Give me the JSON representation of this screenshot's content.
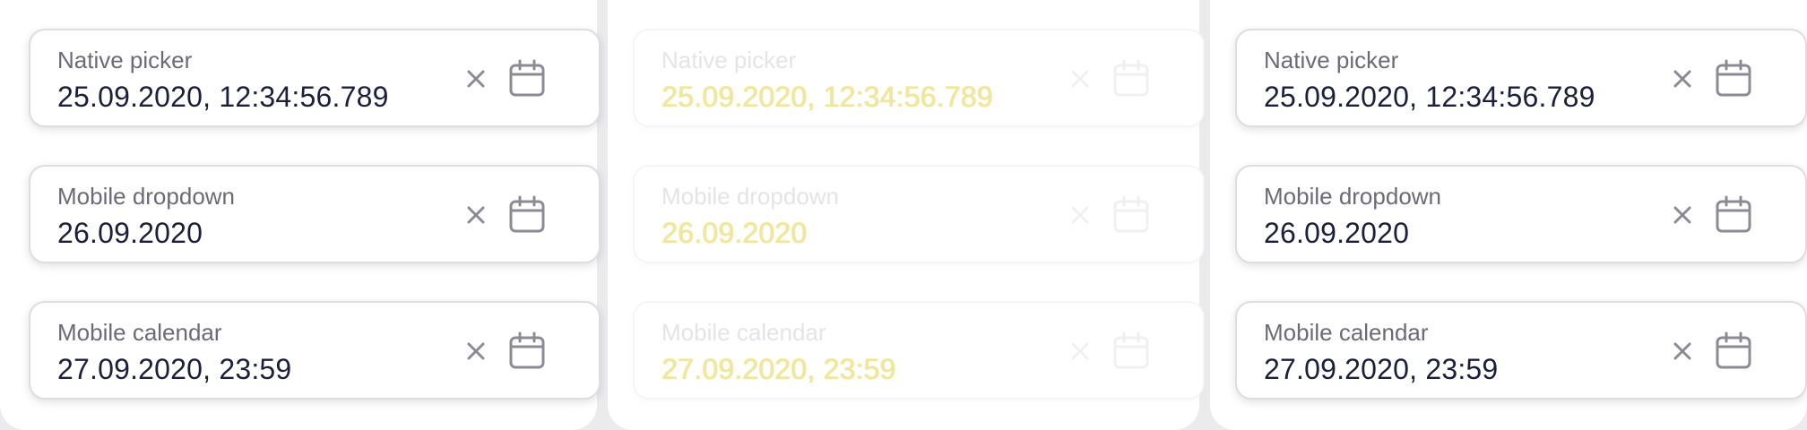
{
  "columns": [
    {
      "state": "enabled",
      "fields": [
        {
          "label": "Native picker",
          "value": "25.09.2020, 12:34:56.789"
        },
        {
          "label": "Mobile dropdown",
          "value": "26.09.2020"
        },
        {
          "label": "Mobile calendar",
          "value": "27.09.2020, 23:59"
        }
      ]
    },
    {
      "state": "disabled",
      "fields": [
        {
          "label": "Native picker",
          "value": "25.09.2020, 12:34:56.789"
        },
        {
          "label": "Mobile dropdown",
          "value": "26.09.2020"
        },
        {
          "label": "Mobile calendar",
          "value": "27.09.2020, 23:59"
        }
      ]
    },
    {
      "state": "enabled",
      "fields": [
        {
          "label": "Native picker",
          "value": "25.09.2020, 12:34:56.789"
        },
        {
          "label": "Mobile dropdown",
          "value": "26.09.2020"
        },
        {
          "label": "Mobile calendar",
          "value": "27.09.2020, 23:59"
        }
      ]
    }
  ],
  "icons": {
    "clear": "close-icon",
    "calendar": "calendar-icon"
  },
  "colors": {
    "text": "#1b1f3b",
    "label": "#6b6b75",
    "icon": "#8b8b95",
    "border": "#dcdce1",
    "disabled_value": "#efe7a0"
  }
}
